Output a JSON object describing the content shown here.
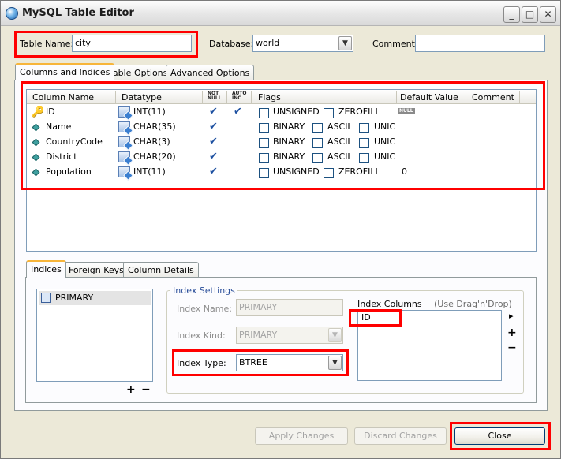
{
  "window": {
    "title": "MySQL Table Editor",
    "controls": {
      "minimize": "_",
      "maximize": "□",
      "close": "✕"
    }
  },
  "top": {
    "table_name_label": "Table Name:",
    "table_name_value": "city",
    "database_label": "Database:",
    "database_value": "world",
    "comment_label": "Comment:",
    "comment_value": ""
  },
  "main_tabs": [
    {
      "label": "Columns and Indices",
      "active": true
    },
    {
      "label": "Table Options",
      "active": false
    },
    {
      "label": "Advanced Options",
      "active": false
    }
  ],
  "grid": {
    "headers": {
      "column_name": "Column Name",
      "datatype": "Datatype",
      "not_null": [
        "NOT",
        "NULL"
      ],
      "auto_inc": [
        "AUTO",
        "INC"
      ],
      "flags": "Flags",
      "default_value": "Default Value",
      "comment": "Comment"
    },
    "rows": [
      {
        "name": "ID",
        "type": "INT(11)",
        "icon": "key-icon",
        "not_null": "✔",
        "auto_inc": "✔",
        "flag1": "UNSIGNED",
        "flag2": "ZEROFILL",
        "flag3": "",
        "default": "NULL"
      },
      {
        "name": "Name",
        "type": "CHAR(35)",
        "icon": "diamond-icon",
        "not_null": "✔",
        "auto_inc": "",
        "flag1": "BINARY",
        "flag2": "ASCII",
        "flag3": "UNIC",
        "default": ""
      },
      {
        "name": "CountryCode",
        "type": "CHAR(3)",
        "icon": "diamond-icon",
        "not_null": "✔",
        "auto_inc": "",
        "flag1": "BINARY",
        "flag2": "ASCII",
        "flag3": "UNIC",
        "default": ""
      },
      {
        "name": "District",
        "type": "CHAR(20)",
        "icon": "diamond-icon",
        "not_null": "✔",
        "auto_inc": "",
        "flag1": "BINARY",
        "flag2": "ASCII",
        "flag3": "UNIC",
        "default": ""
      },
      {
        "name": "Population",
        "type": "INT(11)",
        "icon": "diamond-icon",
        "not_null": "✔",
        "auto_inc": "",
        "flag1": "UNSIGNED",
        "flag2": "ZEROFILL",
        "flag3": "",
        "default": "0"
      }
    ]
  },
  "sub_tabs": [
    {
      "label": "Indices",
      "active": true
    },
    {
      "label": "Foreign Keys",
      "active": false
    },
    {
      "label": "Column Details",
      "active": false
    }
  ],
  "indices": {
    "list": [
      "PRIMARY"
    ],
    "add": "+",
    "remove": "−"
  },
  "index_settings": {
    "legend": "Index Settings",
    "name_label": "Index Name:",
    "name_value": "PRIMARY",
    "kind_label": "Index Kind:",
    "kind_value": "PRIMARY",
    "type_label": "Index Type:",
    "type_value": "BTREE",
    "columns_label": "Index Columns",
    "columns_hint": "(Use Drag'n'Drop)",
    "columns": [
      "ID"
    ],
    "arrow": "▸",
    "add": "+",
    "remove": "−"
  },
  "buttons": {
    "apply": "Apply Changes",
    "discard": "Discard Changes",
    "close": "Close"
  }
}
